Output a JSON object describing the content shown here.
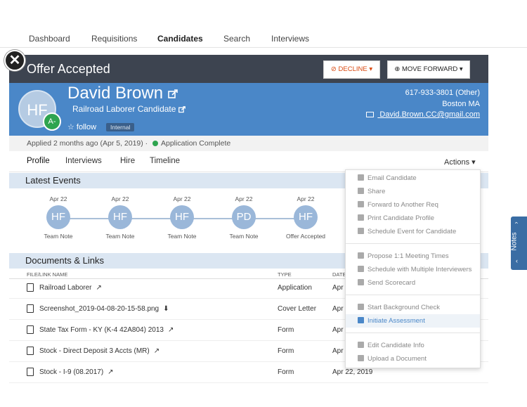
{
  "topnav": {
    "tabs": [
      {
        "label": "Dashboard",
        "active": false
      },
      {
        "label": "Requisitions",
        "active": false
      },
      {
        "label": "Candidates",
        "active": true
      },
      {
        "label": "Search",
        "active": false
      },
      {
        "label": "Interviews",
        "active": false
      }
    ]
  },
  "modal": {
    "close_icon": "✕",
    "title": "Offer Accepted",
    "decline_label": "⊘ DECLINE ▾",
    "forward_label": "⊕ MOVE FORWARD ▾"
  },
  "candidate": {
    "initials": "HF",
    "grade": "A-",
    "name": "David Brown",
    "role": "Railroad Laborer Candidate",
    "follow_label": "☆ follow",
    "badge": "Internal",
    "phone": "617-933-3801 (Other)",
    "location": "Boston MA",
    "email": "David.Brown.CC@gmail.com"
  },
  "status": {
    "applied": "Applied 2 months ago (Apr 5, 2019)  ·",
    "complete": "Application Complete"
  },
  "subtabs": {
    "items": [
      "Profile",
      "Interviews",
      "Hire",
      "Timeline"
    ],
    "actions_label": "Actions ▾"
  },
  "latest_events": {
    "heading": "Latest Events",
    "events": [
      {
        "date": "Apr 22",
        "initials": "HF",
        "label": "Team Note"
      },
      {
        "date": "Apr 22",
        "initials": "HF",
        "label": "Team Note"
      },
      {
        "date": "Apr 22",
        "initials": "HF",
        "label": "Team Note"
      },
      {
        "date": "Apr 22",
        "initials": "PD",
        "label": "Team Note"
      },
      {
        "date": "Apr 22",
        "initials": "HF",
        "label": "Offer Accepted"
      }
    ]
  },
  "documents": {
    "heading": "Documents & Links",
    "columns": {
      "name": "FILE/LINK NAME",
      "type": "TYPE",
      "date": "DATE"
    },
    "rows": [
      {
        "name": "Railroad Laborer",
        "ext_icon": "↗",
        "type": "Application",
        "date": "Apr"
      },
      {
        "name": "Screenshot_2019-04-08-20-15-58.png",
        "ext_icon": "⬇",
        "type": "Cover Letter",
        "date": "Apr"
      },
      {
        "name": "State Tax Form - KY (K-4 42A804) 2013",
        "ext_icon": "↗",
        "type": "Form",
        "date": "Apr"
      },
      {
        "name": "Stock - Direct Deposit 3 Accts (MR)",
        "ext_icon": "↗",
        "type": "Form",
        "date": "Apr"
      },
      {
        "name": "Stock - I-9 (08.2017)",
        "ext_icon": "↗",
        "type": "Form",
        "date": "Apr 22, 2019"
      }
    ]
  },
  "actions_menu": {
    "group1": [
      "Email Candidate",
      "Share",
      "Forward to Another Req",
      "Print Candidate Profile",
      "Schedule Event for Candidate"
    ],
    "group2": [
      "Propose 1:1 Meeting Times",
      "Schedule with Multiple Interviewers",
      "Send Scorecard"
    ],
    "group3": [
      "Start Background Check",
      "Initiate Assessment"
    ],
    "group4": [
      "Edit Candidate Info",
      "Upload a Document"
    ],
    "highlighted": "Initiate Assessment"
  },
  "notes_tab": {
    "label": "Notes",
    "chev_up": "‹",
    "chev_down": "‹"
  },
  "colors": {
    "header_blue": "#4a87c8",
    "titlebar": "#3d4450",
    "decline": "#d9480f",
    "complete_green": "#2ea44f"
  }
}
